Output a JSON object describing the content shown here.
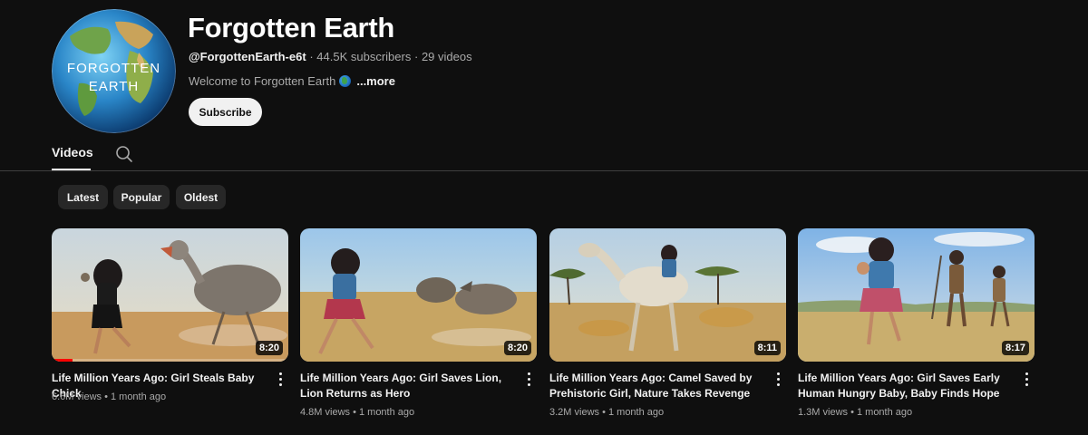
{
  "channel": {
    "name": "Forgotten Earth",
    "handle": "@ForgottenEarth-e6t",
    "separator": "·",
    "subscribers": "44.5K subscribers",
    "videos_count": "29 videos",
    "description": "Welcome to Forgotten Earth",
    "more_label": "...more",
    "subscribe_label": "Subscribe",
    "avatar_text_line1": "FORGOTTEN",
    "avatar_text_line2": "EARTH"
  },
  "tabs": {
    "videos_label": "Videos"
  },
  "filters": [
    "Latest",
    "Popular",
    "Oldest"
  ],
  "videos": [
    {
      "title": "Life Million Years Ago: Girl Steals Baby Chick",
      "duration": "8:20",
      "views": "6.6M views • 1 month ago",
      "watched_progress": 0.09
    },
    {
      "title": "Life Million Years Ago: Girl Saves Lion, Lion Returns as Hero",
      "duration": "8:20",
      "views": "4.8M views • 1 month ago"
    },
    {
      "title": "Life Million Years Ago: Camel Saved by Prehistoric Girl, Nature Takes Revenge",
      "duration": "8:11",
      "views": "3.2M views • 1 month ago"
    },
    {
      "title": "Life Million Years Ago: Girl Saves Early Human Hungry Baby, Baby Finds Hope",
      "duration": "8:17",
      "views": "1.3M views • 1 month ago"
    }
  ],
  "colors": {
    "background": "#0f0f0f",
    "chip": "#272727",
    "progress": "#ff0000"
  },
  "icons": {
    "search": "search-icon",
    "more": "more-vert-icon"
  }
}
